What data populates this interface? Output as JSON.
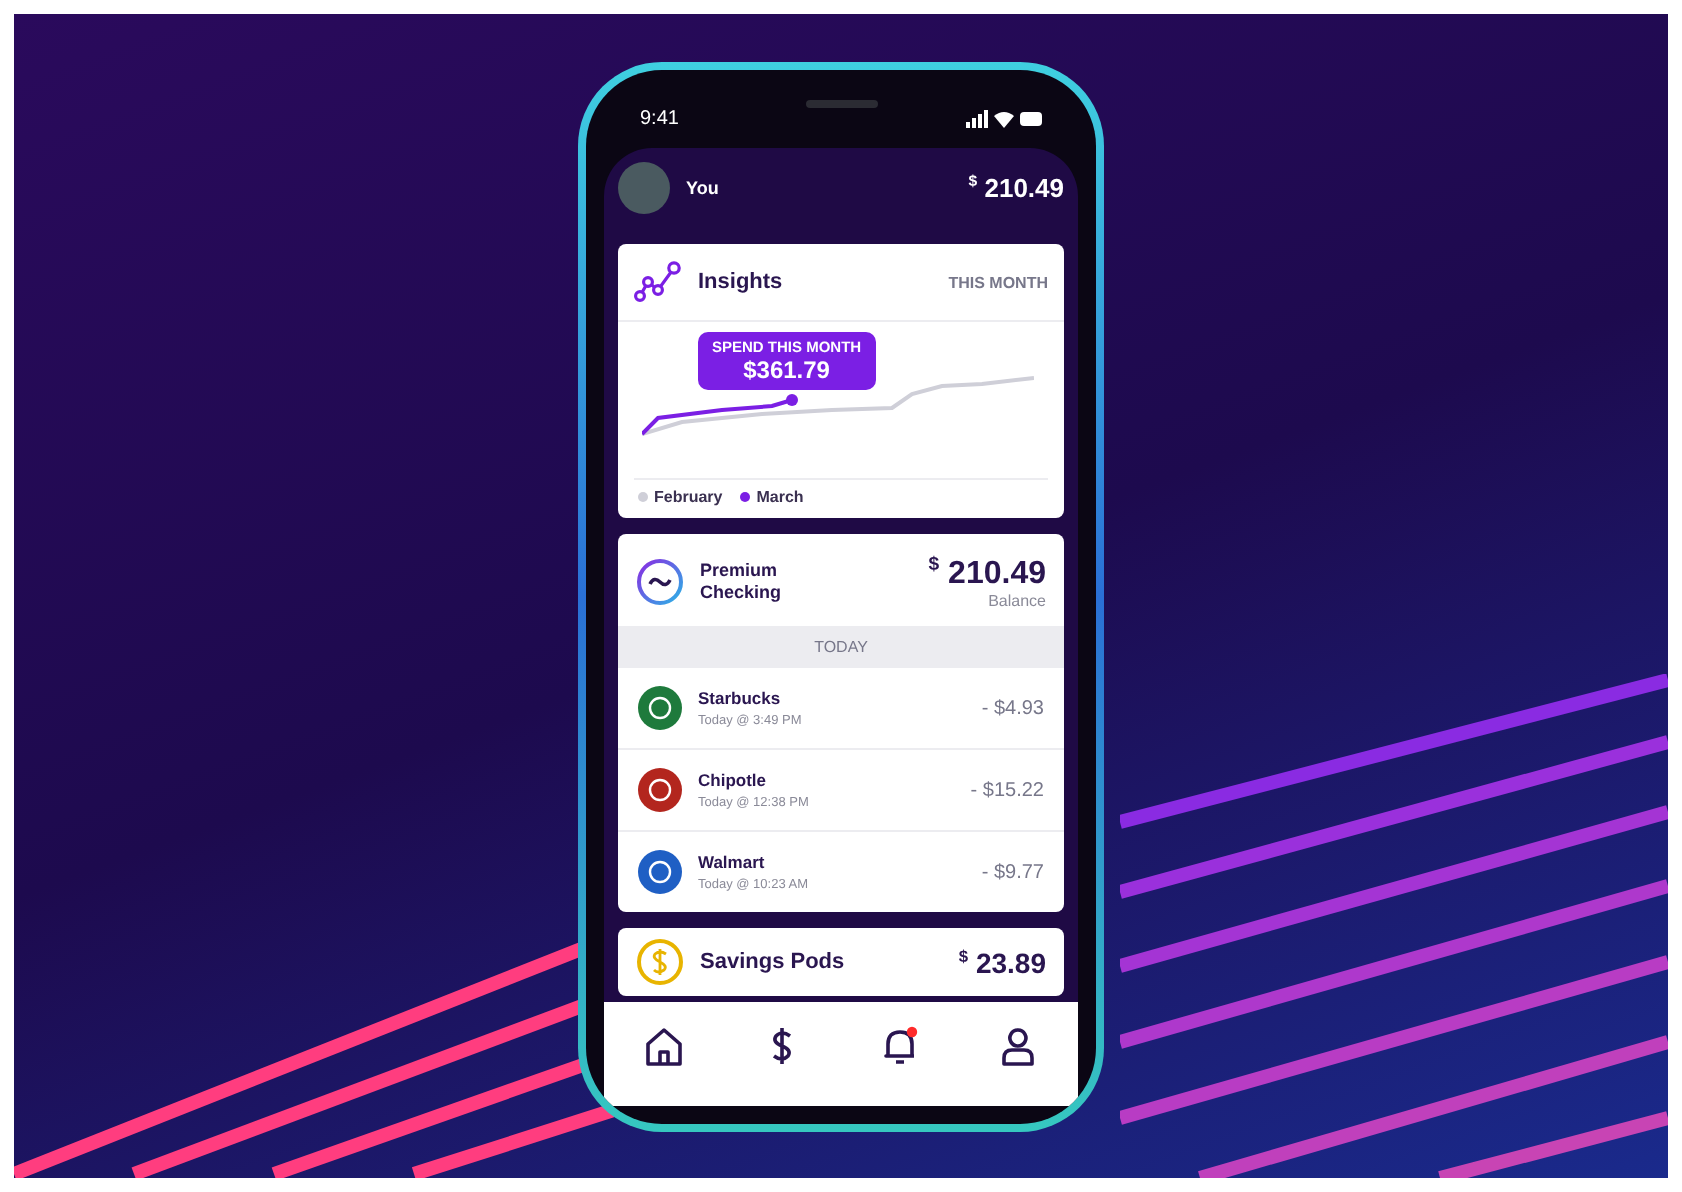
{
  "status_bar": {
    "time": "9:41"
  },
  "header": {
    "name": "You",
    "currency": "$",
    "balance": "210.49"
  },
  "insights": {
    "title": "Insights",
    "period": "THIS MONTH",
    "tooltip": {
      "label": "SPEND THIS MONTH",
      "amount": "$361.79"
    },
    "legend": [
      {
        "label": "February",
        "color": "#cfcfd8"
      },
      {
        "label": "March",
        "color": "#7b1fe4"
      }
    ]
  },
  "account": {
    "name": "Premium Checking",
    "currency": "$",
    "balance": "210.49",
    "caption": "Balance",
    "section": "TODAY",
    "transactions": [
      {
        "merchant": "Starbucks",
        "time": "Today @ 3:49 PM",
        "amount": "- $4.93",
        "color": "#1e7a3c"
      },
      {
        "merchant": "Chipotle",
        "time": "Today @ 12:38 PM",
        "amount": "- $15.22",
        "color": "#b3261e"
      },
      {
        "merchant": "Walmart",
        "time": "Today @ 10:23 AM",
        "amount": "- $9.77",
        "color": "#1f5fc4"
      }
    ]
  },
  "savings": {
    "name": "Savings Pods",
    "currency": "$",
    "balance": "23.89"
  },
  "nav": [
    {
      "kind": "home"
    },
    {
      "kind": "dollar"
    },
    {
      "kind": "bell",
      "badge": true
    },
    {
      "kind": "person"
    }
  ]
}
